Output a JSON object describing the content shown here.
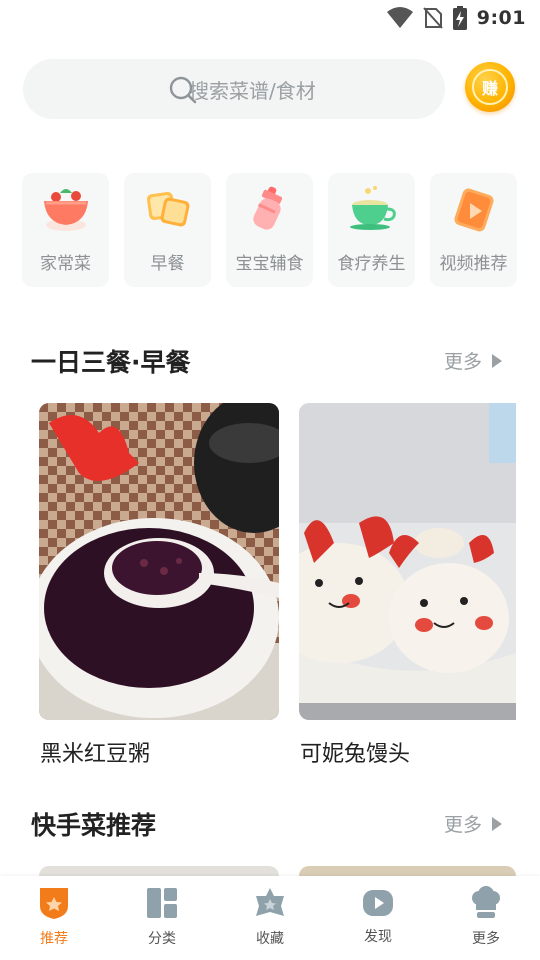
{
  "status_bar": {
    "time": "9:01"
  },
  "search": {
    "placeholder": "搜索菜谱/食材"
  },
  "earn_badge": {
    "label": "赚"
  },
  "categories": [
    {
      "label": "家常菜",
      "icon": "salad-bowl-icon"
    },
    {
      "label": "早餐",
      "icon": "toast-icon"
    },
    {
      "label": "宝宝辅食",
      "icon": "baby-bottle-icon"
    },
    {
      "label": "食疗养生",
      "icon": "tea-cup-icon"
    },
    {
      "label": "视频推荐",
      "icon": "video-play-icon"
    }
  ],
  "sections": [
    {
      "title": "一日三餐·早餐",
      "more_label": "更多",
      "recipes": [
        {
          "title": "黑米红豆粥"
        },
        {
          "title": "可妮兔馒头"
        }
      ]
    },
    {
      "title": "快手菜推荐",
      "more_label": "更多"
    }
  ],
  "bottom_nav": [
    {
      "label": "推荐",
      "icon": "recommend-icon",
      "active": true
    },
    {
      "label": "分类",
      "icon": "category-icon",
      "active": false
    },
    {
      "label": "收藏",
      "icon": "favorite-icon",
      "active": false
    },
    {
      "label": "发现",
      "icon": "discover-play-icon",
      "active": false
    },
    {
      "label": "更多",
      "icon": "chef-hat-icon",
      "active": false
    }
  ],
  "colors": {
    "accent": "#f37c1a",
    "badge_gold": "#ffb300",
    "muted_text": "#9aa0a3",
    "card_bg": "#f6f8f7"
  }
}
